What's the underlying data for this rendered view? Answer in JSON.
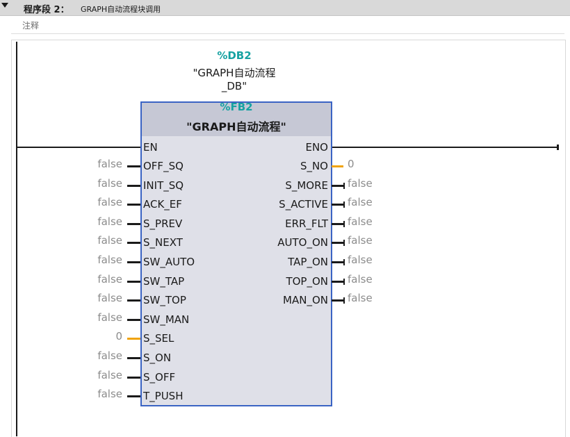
{
  "network": {
    "title": "程序段 2：",
    "name": "GRAPH自动流程块调用",
    "comment": "注释"
  },
  "instance_db": {
    "address": "%DB2",
    "name_line1": "\"GRAPH自动流程",
    "name_line2": "_DB\""
  },
  "block": {
    "address": "%FB2",
    "name": "\"GRAPH自动流程\"",
    "en": "EN",
    "eno": "ENO"
  },
  "inputs": [
    {
      "pin": "OFF_SQ",
      "value": "false",
      "type": "bool"
    },
    {
      "pin": "INIT_SQ",
      "value": "false",
      "type": "bool"
    },
    {
      "pin": "ACK_EF",
      "value": "false",
      "type": "bool"
    },
    {
      "pin": "S_PREV",
      "value": "false",
      "type": "bool"
    },
    {
      "pin": "S_NEXT",
      "value": "false",
      "type": "bool"
    },
    {
      "pin": "SW_AUTO",
      "value": "false",
      "type": "bool"
    },
    {
      "pin": "SW_TAP",
      "value": "false",
      "type": "bool"
    },
    {
      "pin": "SW_TOP",
      "value": "false",
      "type": "bool"
    },
    {
      "pin": "SW_MAN",
      "value": "false",
      "type": "bool"
    },
    {
      "pin": "S_SEL",
      "value": "0",
      "type": "int"
    },
    {
      "pin": "S_ON",
      "value": "false",
      "type": "bool"
    },
    {
      "pin": "S_OFF",
      "value": "false",
      "type": "bool"
    },
    {
      "pin": "T_PUSH",
      "value": "false",
      "type": "bool"
    }
  ],
  "outputs": [
    {
      "pin": "S_NO",
      "value": "0",
      "type": "int"
    },
    {
      "pin": "S_MORE",
      "value": "false",
      "type": "bool"
    },
    {
      "pin": "S_ACTIVE",
      "value": "false",
      "type": "bool"
    },
    {
      "pin": "ERR_FLT",
      "value": "false",
      "type": "bool"
    },
    {
      "pin": "AUTO_ON",
      "value": "false",
      "type": "bool"
    },
    {
      "pin": "TAP_ON",
      "value": "false",
      "type": "bool"
    },
    {
      "pin": "TOP_ON",
      "value": "false",
      "type": "bool"
    },
    {
      "pin": "MAN_ON",
      "value": "false",
      "type": "bool"
    }
  ],
  "colors": {
    "header_bg": "#d9d9d9",
    "address": "#17a2a2",
    "box_border": "#3a63c4",
    "box_fill": "#dfe0e8",
    "box_header": "#c6c8d5",
    "int_wire": "#f0a30a",
    "value_text": "#8c8c8c"
  },
  "icons": {
    "collapse": "triangle-down-icon"
  }
}
